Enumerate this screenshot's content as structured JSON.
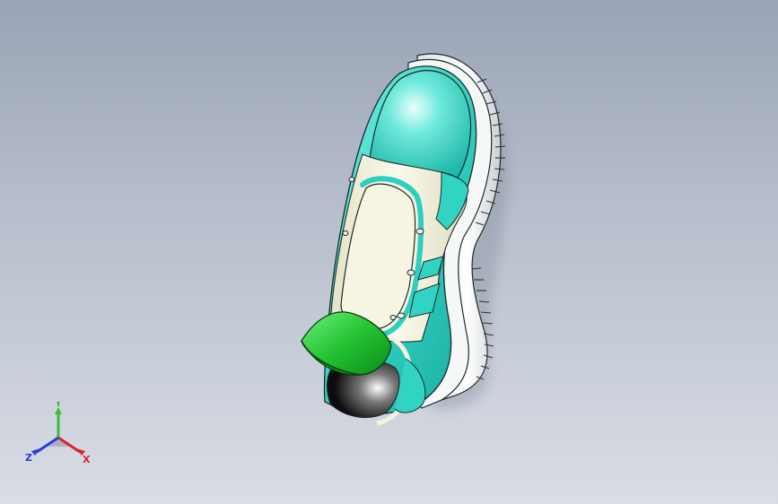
{
  "viewport": {
    "background_top": "#9aa4b6",
    "background_bottom": "#d9dde5"
  },
  "model": {
    "description_icon": "shoe-3d-model",
    "colors": {
      "upper": "#35d6c6",
      "upper_highlight": "#a8f4ec",
      "panel": "#f3f2dc",
      "sole": "#f4f6f7",
      "heel_cap": "#2fcf3c",
      "edge": "#1f2a2a"
    }
  },
  "triad": {
    "x_label": "X",
    "y_label": "Y",
    "z_label": "Z",
    "x_color": "#d8262c",
    "y_color": "#35c03c",
    "z_color": "#2b3cd6"
  }
}
